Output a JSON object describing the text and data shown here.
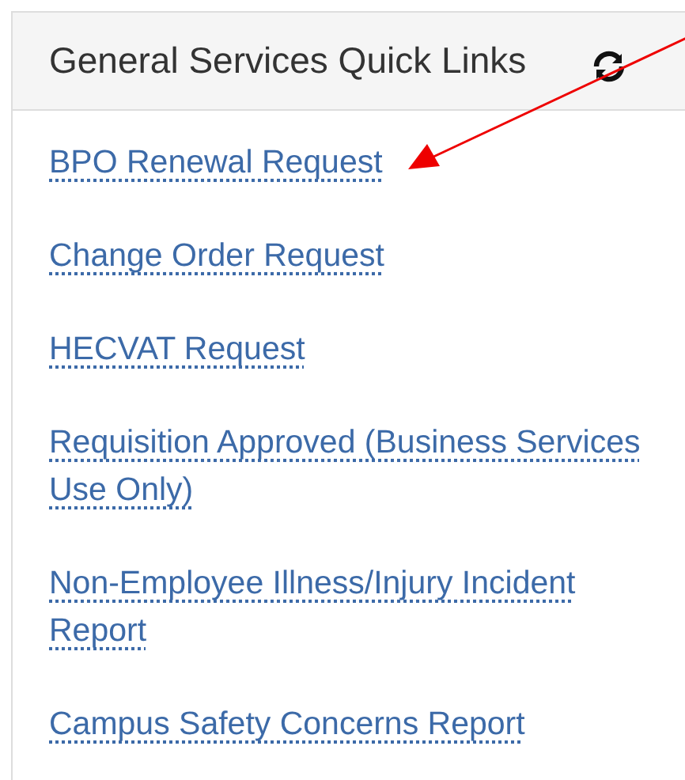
{
  "panel": {
    "title": "General Services Quick Links"
  },
  "links": [
    {
      "label": "BPO Renewal Request"
    },
    {
      "label": "Change Order Request"
    },
    {
      "label": "HECVAT Request"
    },
    {
      "label": "Requisition Approved (Business Services Use Only)"
    },
    {
      "label": "Non-Employee Illness/Injury Incident Report"
    },
    {
      "label": "Campus Safety Concerns Report"
    }
  ]
}
